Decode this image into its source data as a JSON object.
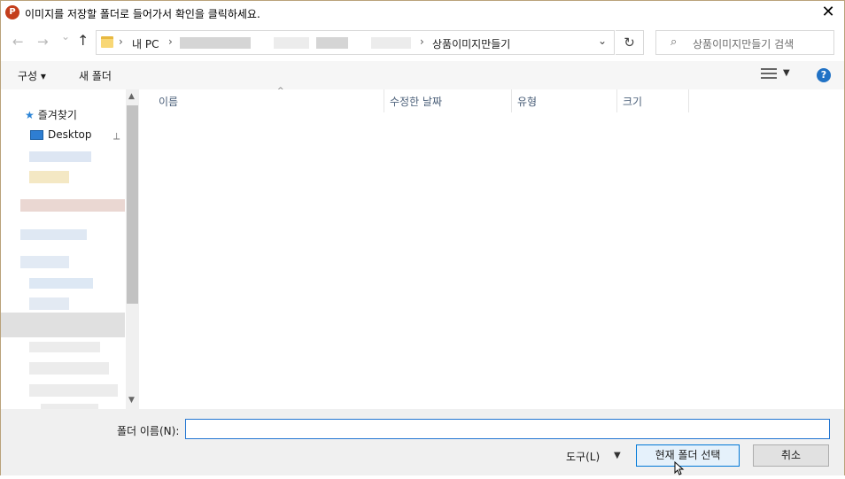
{
  "titlebar": {
    "title": "이미지를 저장할 폴더로 들어가서 확인을 클릭하세요.",
    "app_icon_letter": "P",
    "close_glyph": "✕"
  },
  "nav": {
    "back_glyph": "←",
    "forward_glyph": "→",
    "recent_glyph": "⌄",
    "up_glyph": "↑"
  },
  "address": {
    "crumbs": [
      "내 PC",
      "상품이미지만들기"
    ],
    "separator": "›",
    "dropdown_glyph": "⌄",
    "refresh_glyph": "↻"
  },
  "search": {
    "placeholder": "상품이미지만들기 검색",
    "icon": "⌕"
  },
  "toolbar": {
    "organize_label": "구성 ▾",
    "new_folder_label": "새 폴더",
    "view_dropdown_glyph": "▼",
    "help_glyph": "?"
  },
  "sidebar": {
    "favorites_label": "즐겨찾기",
    "star_glyph": "★",
    "desktop_label": "Desktop",
    "pin_glyph": "📌",
    "scroll_up": "▲",
    "scroll_down": "▼"
  },
  "filelist": {
    "columns": [
      "이름",
      "수정한 날짜",
      "유형",
      "크기"
    ],
    "sort_glyph": "^"
  },
  "bottom": {
    "folder_name_label": "폴더 이름(N):",
    "folder_name_value": "",
    "tools_label": "도구(L)",
    "tools_drop": "▼",
    "select_folder_label": "현재 폴더 선택",
    "cancel_label": "취소"
  },
  "colors": {
    "accent": "#0078d7",
    "help": "#2172c5",
    "app_icon": "#c43e1c"
  }
}
